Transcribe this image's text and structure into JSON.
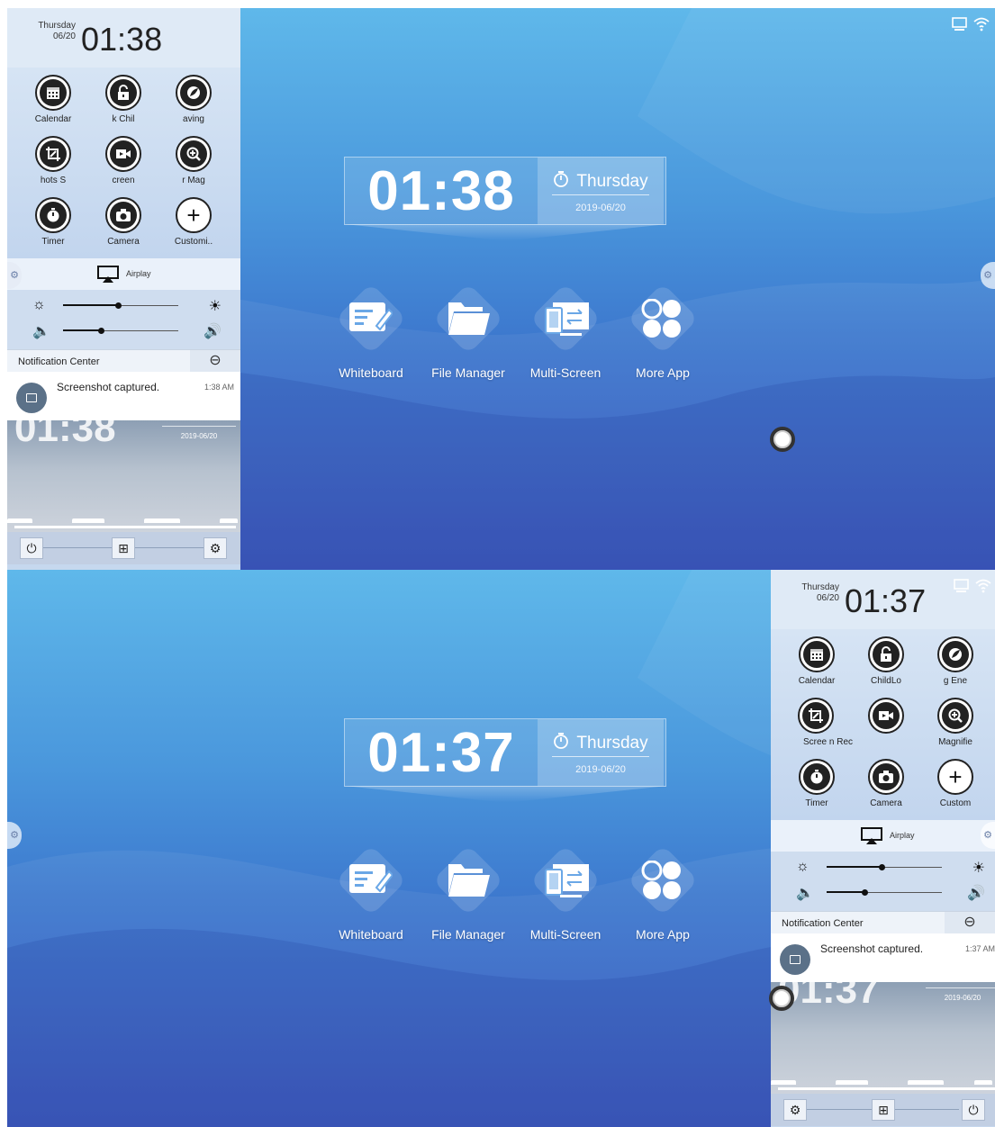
{
  "top": {
    "clock": {
      "time": "01:38",
      "weekday": "Thursday",
      "date": "2019-06/20"
    },
    "apps": [
      {
        "label": "Whiteboard",
        "icon": "whiteboard-icon"
      },
      {
        "label": "File Manager",
        "icon": "folder-icon"
      },
      {
        "label": "Multi-Screen",
        "icon": "multi-screen-icon"
      },
      {
        "label": "More App",
        "icon": "more-app-icon"
      }
    ],
    "panel": {
      "weekday": "Thursday",
      "date": "06/20",
      "time": "01:38",
      "tiles": [
        {
          "label": "Calendar",
          "icon": "calendar-icon"
        },
        {
          "label": "k   Chil",
          "icon": "child-lock-icon"
        },
        {
          "label": "aving",
          "icon": "energy-saving-icon"
        },
        {
          "label": "hots   S",
          "icon": "screenshot-icon"
        },
        {
          "label": "creen",
          "icon": "screen-record-icon"
        },
        {
          "label": "r   Mag",
          "icon": "magnifier-icon"
        },
        {
          "label": "Timer",
          "icon": "timer-icon"
        },
        {
          "label": "Camera",
          "icon": "camera-icon"
        },
        {
          "label": "Customi..",
          "icon": "plus-icon"
        }
      ],
      "airplay": "Airplay",
      "brightness": 0.48,
      "volume": 0.33,
      "notification_center": "Notification Center",
      "notification": {
        "message": "Screenshot captured.",
        "time": "1:38 AM"
      },
      "ghost_time": "01:38",
      "ghost_date": "2019-06/20"
    }
  },
  "bottom": {
    "clock": {
      "time": "01:37",
      "weekday": "Thursday",
      "date": "2019-06/20"
    },
    "apps": [
      {
        "label": "Whiteboard",
        "icon": "whiteboard-icon"
      },
      {
        "label": "File Manager",
        "icon": "folder-icon"
      },
      {
        "label": "Multi-Screen",
        "icon": "multi-screen-icon"
      },
      {
        "label": "More App",
        "icon": "more-app-icon"
      }
    ],
    "panel": {
      "weekday": "Thursday",
      "date": "06/20",
      "time": "01:37",
      "tiles": [
        {
          "label": "Calendar",
          "icon": "calendar-icon"
        },
        {
          "label": "ChildLo",
          "icon": "child-lock-icon"
        },
        {
          "label": "g   Ene",
          "icon": "energy-saving-icon"
        },
        {
          "label": "Scree   n   Rec",
          "icon": "screenshot-icon"
        },
        {
          "label": "",
          "icon": "screen-record-icon"
        },
        {
          "label": "Magnifie",
          "icon": "magnifier-icon"
        },
        {
          "label": "Timer",
          "icon": "timer-icon"
        },
        {
          "label": "Camera",
          "icon": "camera-icon"
        },
        {
          "label": "Custom",
          "icon": "plus-icon"
        }
      ],
      "airplay": "Airplay",
      "brightness": 0.48,
      "volume": 0.33,
      "notification_center": "Notification Center",
      "notification": {
        "message": "Screenshot captured.",
        "time": "1:37 AM"
      },
      "ghost_time": "01:37",
      "ghost_date": "2019-06/20"
    }
  }
}
